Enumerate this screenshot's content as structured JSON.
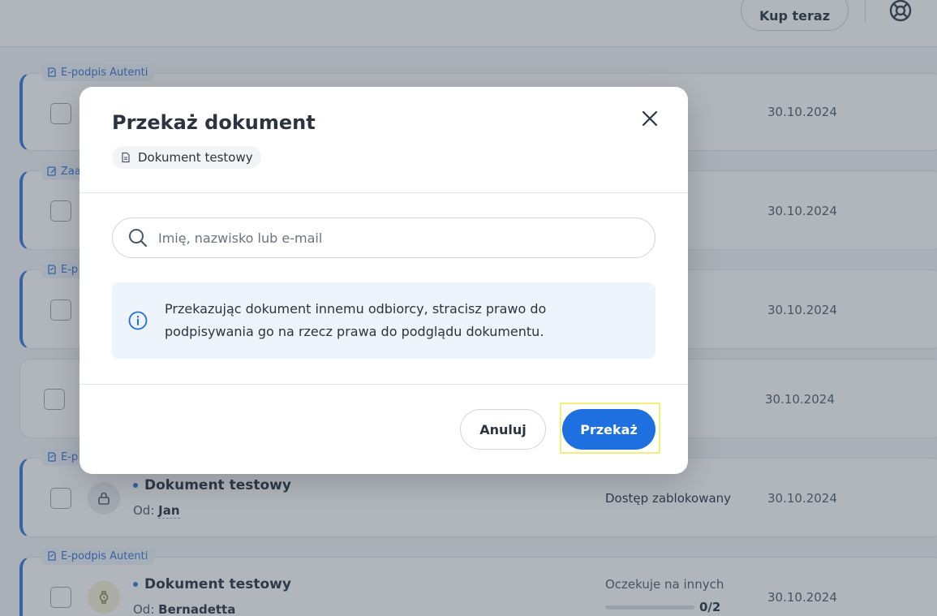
{
  "topbar": {
    "buy_label": "Kup teraz",
    "help_icon": "lifebuoy-icon"
  },
  "list": {
    "rows": [
      {
        "tag": "E-podpis Autenti",
        "date": "30.10.2024"
      },
      {
        "tag": "Zaa",
        "date": "30.10.2024"
      },
      {
        "tag": "E-p",
        "date": "30.10.2024"
      },
      {
        "tag": "",
        "date": "30.10.2024"
      },
      {
        "tag": "E-p",
        "title": "Dokument testowy",
        "from_label": "Od:",
        "from_name": "Jan",
        "status": "Dostęp zablokowany",
        "date": "30.10.2024"
      },
      {
        "tag": "E-podpis Autenti",
        "title": "Dokument testowy",
        "from_label": "Od:",
        "from_name": "Bernadetta",
        "status": "Oczekuje na innych",
        "progress": "0/2",
        "progress_fraction": 0,
        "date": "30.10.2024"
      }
    ]
  },
  "modal": {
    "title": "Przekaż dokument",
    "document_name": "Dokument testowy",
    "search_placeholder": "Imię, nazwisko lub e-mail",
    "search_value": "",
    "info_text": "Przekazując dokument innemu odbiorcy, stracisz prawo do podpisywania go na rzecz prawa do podglądu dokumentu.",
    "cancel_label": "Anuluj",
    "submit_label": "Przekaż"
  },
  "colors": {
    "accent": "#1e6fe0",
    "info_bg": "#eef4fc",
    "focus_ring": "#f3f07a"
  }
}
